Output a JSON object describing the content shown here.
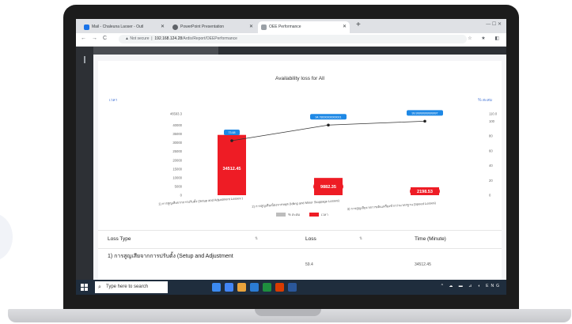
{
  "browser": {
    "tabs": [
      {
        "title": "Mail - Chaleuna Laoser - Outl",
        "favicon_color": "#1a73e8"
      },
      {
        "title": "PowerPoint Presentation",
        "favicon_color": "#5f6368"
      },
      {
        "title": "OEE Performance",
        "favicon_color": "#9aa0a6"
      }
    ],
    "new_tab": "+",
    "window_controls": "—  ☐  ✕",
    "nav": {
      "back": "←",
      "forward": "→",
      "reload": "C"
    },
    "security": "Not secure",
    "url_host": "192.168.124.28",
    "url_path": "/Ardis/Report/OEEPerformance",
    "addr_icons": "☆ ★ ◧"
  },
  "chart_data": {
    "type": "bar",
    "title": "Availability loss for All",
    "ylabel": "เวลา",
    "ylabel_right": "% สะสม",
    "categories": [
      "1) การสูญเสียจากการปรับตั้ง (Setup and Adjustment Losses )",
      "2) การสูญเสียเนื่องจากหยุด (Idling and Minor Stoppage Losses)",
      "3) การสูญเสียจากการเดินเครื่องช้ากว่ามาตรฐาน (Speed Losses)"
    ],
    "series": [
      {
        "name": "เวลา",
        "type": "bar",
        "values": [
          34512.45,
          9882.35,
          2198.53
        ],
        "labels": [
          "34512.45",
          "9882.35",
          "2198.53"
        ],
        "color": "#ee1c25"
      },
      {
        "name": "% สะสม",
        "type": "line",
        "values": [
          73.68,
          94.78,
          100
        ],
        "labels": [
          "73.68",
          "94.78000000000001",
          "99.99999999999997"
        ],
        "color": "#333333"
      }
    ],
    "ylim": [
      0,
      46593.3
    ],
    "y_ticks": [
      "46593.3",
      "40000",
      "35000",
      "30000",
      "25000",
      "20000",
      "15000",
      "10000",
      "5000",
      "0"
    ],
    "y2lim": [
      0,
      110
    ],
    "y2_ticks": [
      "110.0",
      "100",
      "80",
      "60",
      "40",
      "20",
      "0"
    ],
    "legend": [
      "% สะสม",
      "เวลา"
    ],
    "legend_position": "bottom"
  },
  "table": {
    "columns": [
      "Loss Type",
      "Loss",
      "Time (Minute)"
    ],
    "rows": [
      {
        "loss_type": "1) การสูญเสียจากการปรับตั้ง (Setup and Adjustment",
        "loss": "59.4",
        "time": "34512.45"
      }
    ]
  },
  "taskbar": {
    "search_placeholder": "Type here to search",
    "tray": "^ ☁ ▬ ⊿ ◖ ENG",
    "icons": [
      "#3c8af0",
      "#4285f4",
      "#e8a33c",
      "#2b7cd3",
      "#1e8e3e",
      "#d83b01",
      "#2b579a"
    ]
  }
}
